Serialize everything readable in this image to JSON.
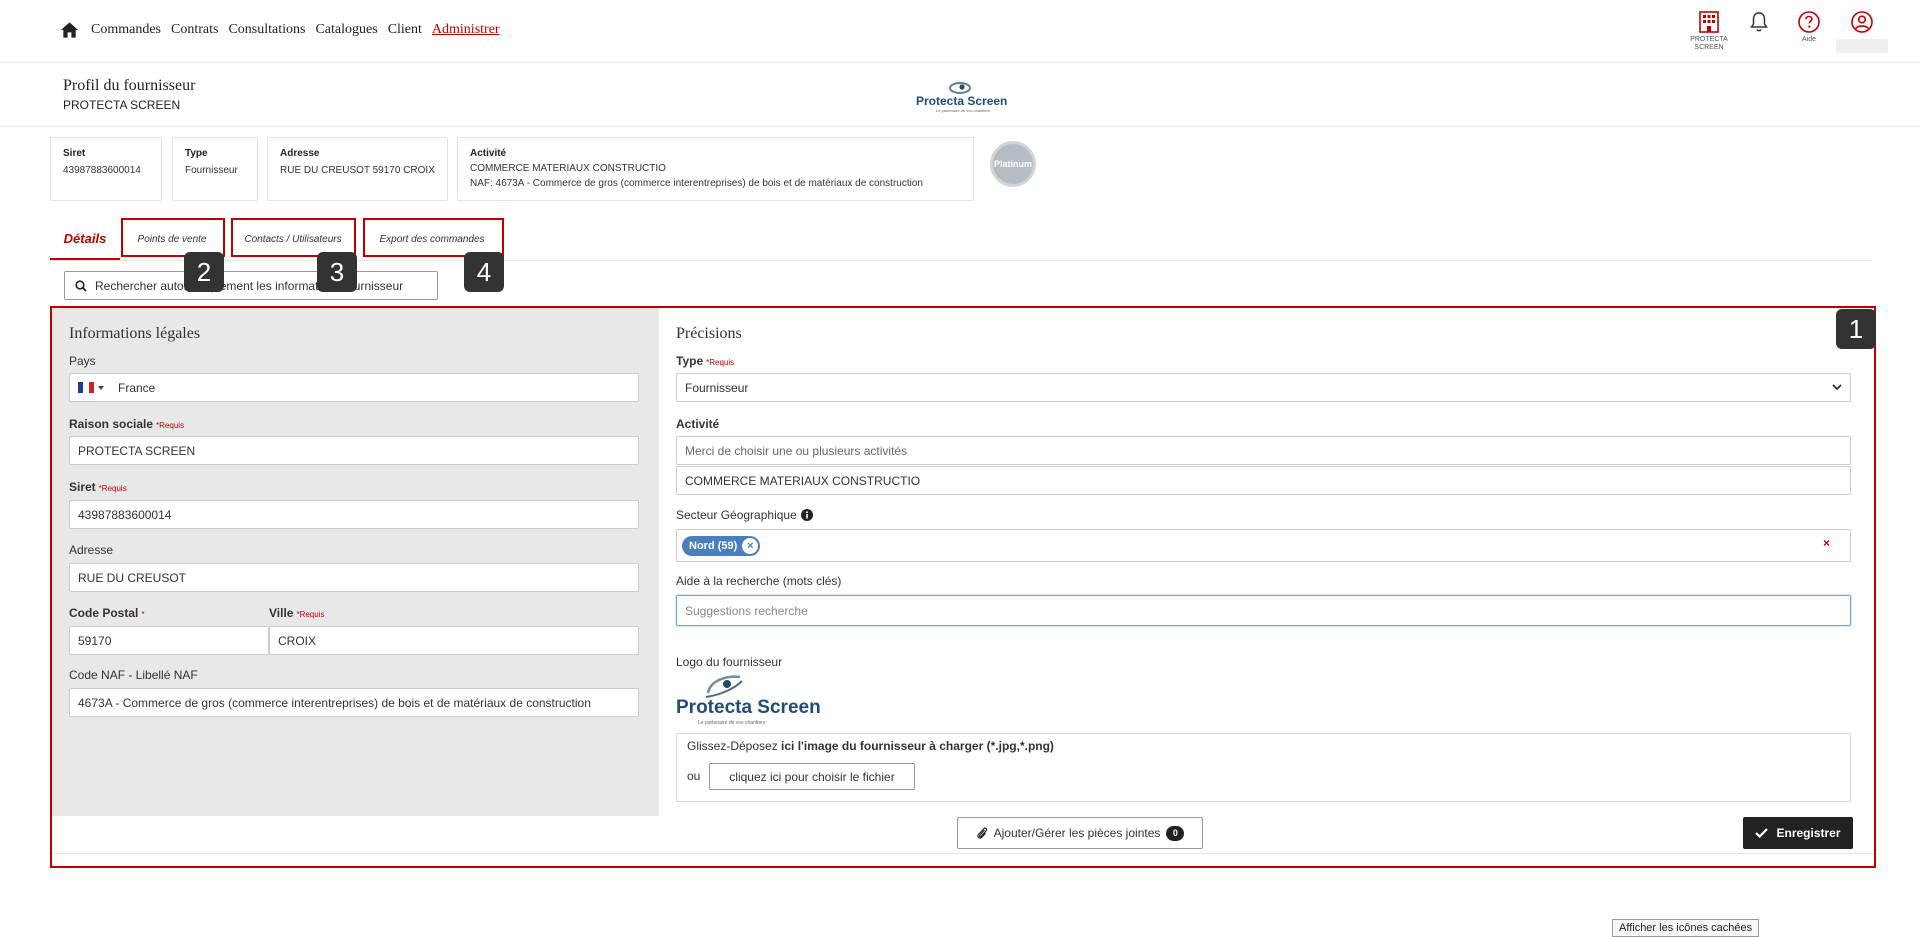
{
  "nav": {
    "items": [
      "Commandes",
      "Contrats",
      "Consultations",
      "Catalogues",
      "Client",
      "Administrer"
    ],
    "active": "Administrer"
  },
  "topicons": {
    "company_label": "PROTECTA SCREEN",
    "help_label": "Aide"
  },
  "header": {
    "title": "Profil du fournisseur",
    "subtitle": "PROTECTA SCREEN",
    "logo_text": "Protecta Screen",
    "logo_tagline": "Le partenaire de vos chantiers"
  },
  "cards": {
    "siret": {
      "label": "Siret",
      "value": "43987883600014"
    },
    "type": {
      "label": "Type",
      "value": "Fournisseur"
    },
    "address": {
      "label": "Adresse",
      "value": "RUE DU CREUSOT 59170 CROIX"
    },
    "activity": {
      "label": "Activité",
      "value": "COMMERCE MATERIAUX CONSTRUCTIO",
      "naf": "NAF: 4673A - Commerce de gros (commerce interentreprises) de bois et de matériaux de construction"
    },
    "badge": "Platinum"
  },
  "tabs": {
    "details": "Détails",
    "points": "Points de vente",
    "contacts": "Contacts / Utilisateurs",
    "export": "Export des commandes"
  },
  "markers": {
    "m1": "1",
    "m2": "2",
    "m3": "3",
    "m4": "4"
  },
  "search_button": "Rechercher automatiquement les informations fournisseur",
  "legal": {
    "title": "Informations légales",
    "pays_label": "Pays",
    "pays_value": "France",
    "raison_label": "Raison sociale",
    "raison_value": "PROTECTA SCREEN",
    "siret_label": "Siret",
    "siret_value": "43987883600014",
    "adresse_label": "Adresse",
    "adresse_value": "RUE DU CREUSOT",
    "cp_label": "Code Postal",
    "cp_value": "59170",
    "ville_label": "Ville",
    "ville_value": "CROIX",
    "naf_label": "Code NAF - Libellé NAF",
    "naf_value": "4673A - Commerce de gros (commerce interentreprises) de bois et de matériaux de construction",
    "required": "*Requis",
    "required_star": "*"
  },
  "precisions": {
    "title": "Précisions",
    "type_label": "Type",
    "type_value": "Fournisseur",
    "activite_label": "Activité",
    "activite_placeholder": "Merci de choisir une ou plusieurs activités",
    "activite_value": "COMMERCE MATERIAUX CONSTRUCTIO",
    "secteur_label": "Secteur Géographique",
    "secteur_chip": "Nord (59)",
    "chip_remove": "×",
    "clear_all": "×",
    "aide_label": "Aide à la recherche (mots clés)",
    "aide_placeholder": "Suggestions recherche",
    "logo_label": "Logo du fournisseur",
    "dropzone_text_pre": "Glissez-Déposez ",
    "dropzone_text_bold": "ici l'image du fournisseur à charger (*.jpg,*.png)",
    "dropzone_or": "ou",
    "dropzone_button": "cliquez ici pour choisir le fichier"
  },
  "footer": {
    "attach_label": "Ajouter/Gérer les pièces jointes",
    "attach_count": "0",
    "save_label": "Enregistrer"
  },
  "tooltip": "Afficher les icônes cachées",
  "colors": {
    "accent": "#c00000",
    "chip": "#4a7fbd",
    "dark": "#222222"
  }
}
